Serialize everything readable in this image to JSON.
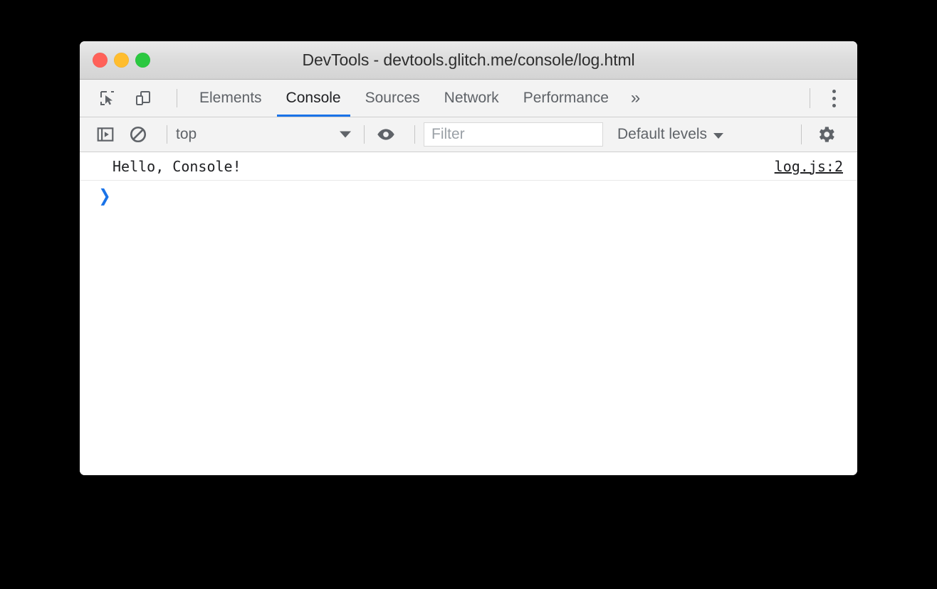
{
  "window": {
    "title": "DevTools - devtools.glitch.me/console/log.html",
    "traffic_lights": [
      {
        "name": "close",
        "color": "#ff6159"
      },
      {
        "name": "minimize",
        "color": "#ffbd2e"
      },
      {
        "name": "maximize",
        "color": "#2bc840"
      }
    ]
  },
  "toolbar": {
    "inspect_icon": "inspect-element-icon",
    "device_icon": "device-toolbar-icon",
    "tabs": [
      {
        "label": "Elements",
        "active": false
      },
      {
        "label": "Console",
        "active": true
      },
      {
        "label": "Sources",
        "active": false
      },
      {
        "label": "Network",
        "active": false
      },
      {
        "label": "Performance",
        "active": false
      }
    ],
    "overflow_label": "»",
    "menu_icon": "kebab-menu-icon",
    "active_tab_color": "#1a73e8"
  },
  "console_toolbar": {
    "sidebar_icon": "console-sidebar-icon",
    "clear_icon": "clear-console-icon",
    "context": {
      "value": "top",
      "caret": "▼"
    },
    "eye_icon": "live-expression-eye-icon",
    "filter": {
      "placeholder": "Filter",
      "value": ""
    },
    "levels": {
      "label": "Default levels",
      "caret": "▼"
    },
    "settings_icon": "gear-icon"
  },
  "console": {
    "messages": [
      {
        "text": "Hello, Console!",
        "source": "log.js:2"
      }
    ],
    "prompt": {
      "chevron": "❯",
      "value": ""
    }
  }
}
